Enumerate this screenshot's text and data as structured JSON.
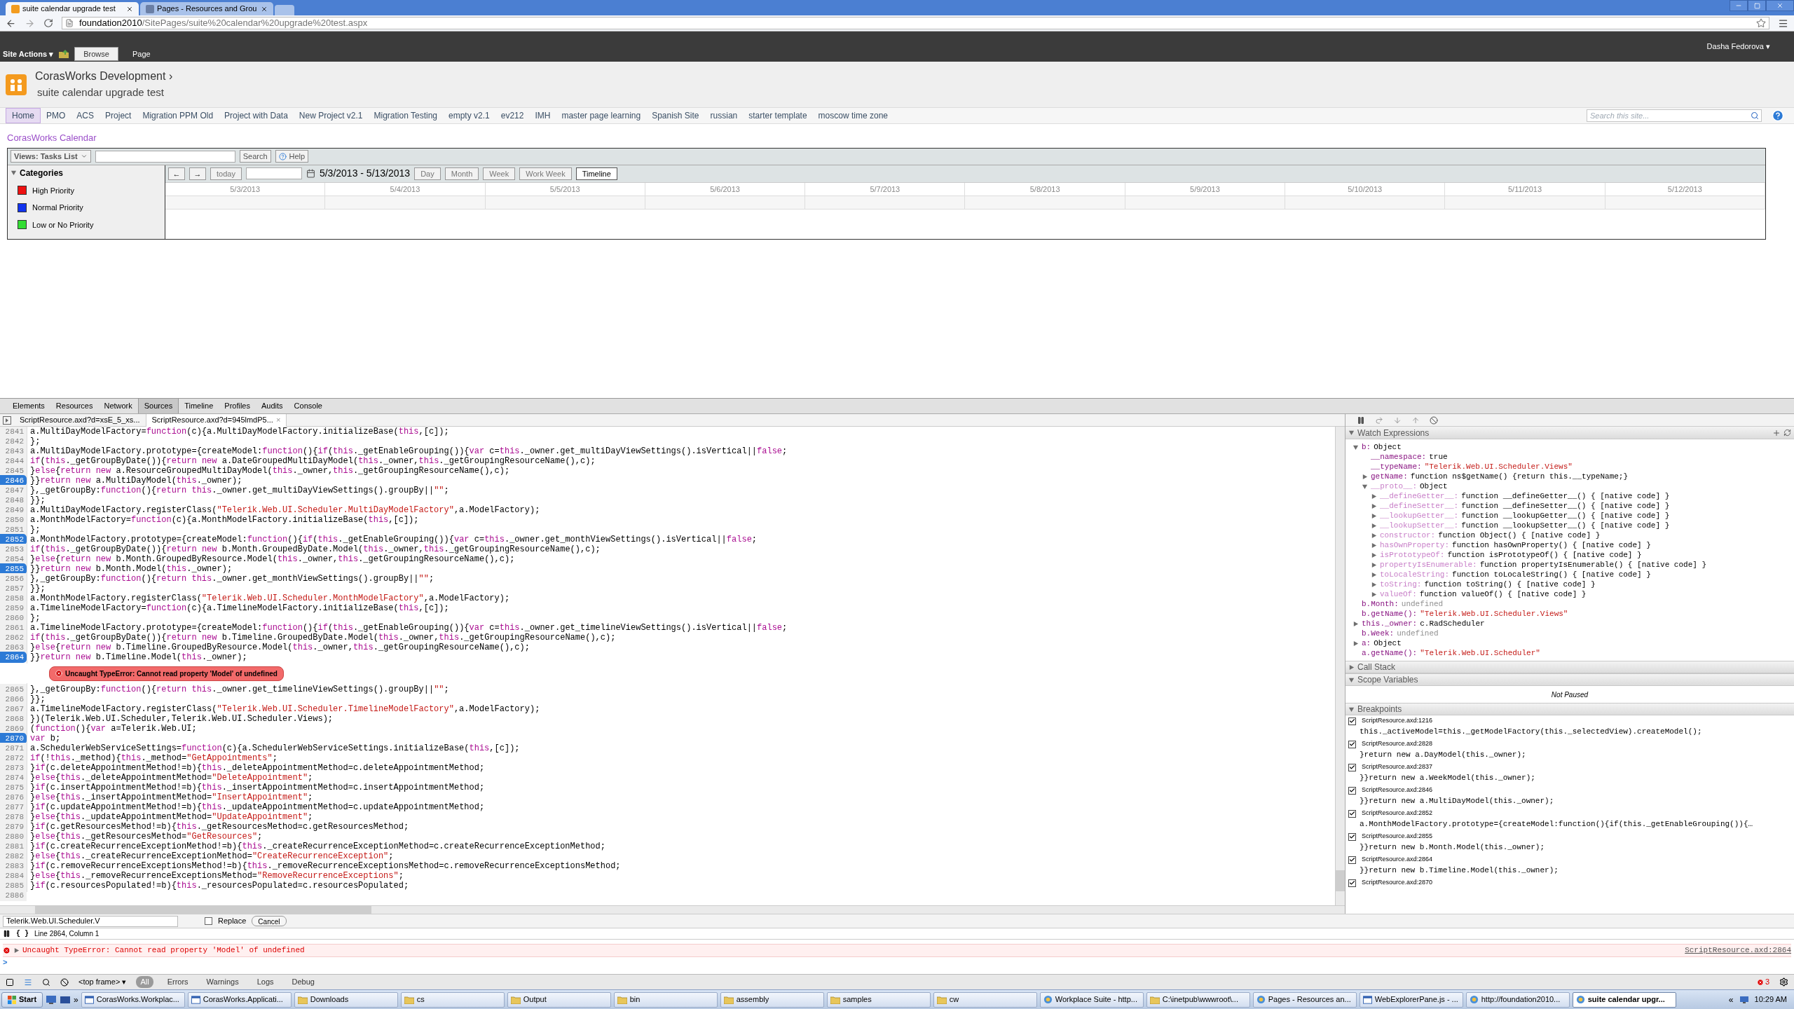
{
  "browser": {
    "tabs": [
      {
        "title": "suite calendar upgrade test",
        "selected": true
      },
      {
        "title": "Pages - Resources and Grou",
        "selected": false
      }
    ],
    "url": {
      "host": "foundation2010",
      "path": "/SitePages/suite%20calendar%20upgrade%20test.aspx"
    }
  },
  "ribbon": {
    "site_actions": "Site Actions",
    "caret": "▾",
    "user_caret": "▾",
    "tabs": [
      {
        "label": "Browse",
        "selected": true
      },
      {
        "label": "Page",
        "selected": false
      }
    ],
    "user": "Dasha Fedorova"
  },
  "site": {
    "title": "CorasWorks Development",
    "title_arrow": "›",
    "page": "suite calendar upgrade test",
    "nav": [
      {
        "label": "Home",
        "selected": true
      },
      {
        "label": "PMO",
        "selected": false
      },
      {
        "label": "ACS",
        "selected": false
      },
      {
        "label": "Project",
        "selected": false
      },
      {
        "label": "Migration PPM Old",
        "selected": false
      },
      {
        "label": "Project with Data",
        "selected": false
      },
      {
        "label": "New Project v2.1",
        "selected": false
      },
      {
        "label": "Migration Testing",
        "selected": false
      },
      {
        "label": "empty v2.1",
        "selected": false
      },
      {
        "label": "ev212",
        "selected": false
      },
      {
        "label": "IMH",
        "selected": false
      },
      {
        "label": "master page learning",
        "selected": false
      },
      {
        "label": "Spanish Site",
        "selected": false
      },
      {
        "label": "russian",
        "selected": false
      },
      {
        "label": "starter template",
        "selected": false
      },
      {
        "label": "moscow time zone",
        "selected": false
      }
    ],
    "search": {
      "placeholder": "Search this site..."
    }
  },
  "calendar": {
    "title": "CorasWorks Calendar",
    "views": "Views: Tasks List",
    "search_button": "Search",
    "help_button": "Help",
    "categories_title": "Categories",
    "categories": [
      {
        "label": "High Priority",
        "color": "#ee1111"
      },
      {
        "label": "Normal Priority",
        "color": "#1133ee"
      },
      {
        "label": "Low or No Priority",
        "color": "#33dd33"
      }
    ],
    "prev": "←",
    "next": "→",
    "today": "today",
    "range": "5/3/2013 - 5/13/2013",
    "views_buttons": [
      {
        "label": "Day",
        "selected": false
      },
      {
        "label": "Month",
        "selected": false
      },
      {
        "label": "Week",
        "selected": false
      },
      {
        "label": "Work Week",
        "selected": false
      },
      {
        "label": "Timeline",
        "selected": true
      }
    ],
    "dates": [
      "5/3/2013",
      "5/4/2013",
      "5/5/2013",
      "5/6/2013",
      "5/7/2013",
      "5/8/2013",
      "5/9/2013",
      "5/10/2013",
      "5/11/2013",
      "5/12/2013"
    ]
  },
  "devtools": {
    "tabs": [
      {
        "label": "Elements",
        "selected": false
      },
      {
        "label": "Resources",
        "selected": false
      },
      {
        "label": "Network",
        "selected": false
      },
      {
        "label": "Sources",
        "selected": true
      },
      {
        "label": "Timeline",
        "selected": false
      },
      {
        "label": "Profiles",
        "selected": false
      },
      {
        "label": "Audits",
        "selected": false
      },
      {
        "label": "Console",
        "selected": false
      }
    ],
    "files": [
      {
        "label": "ScriptResource.axd?d=xsE_5_xs...",
        "selected": false
      },
      {
        "label": "ScriptResource.axd?d=945lmdP5...",
        "selected": true,
        "close": "×"
      }
    ],
    "code": [
      {
        "n": "2841",
        "text": "a.MultiDayModelFactory=function(c){a.MultiDayModelFactory.initializeBase(this,[c]);",
        "breakpoint": false
      },
      {
        "n": "2842",
        "text": "};",
        "breakpoint": false
      },
      {
        "n": "2843",
        "text": "a.MultiDayModelFactory.prototype={createModel:function(){if(this._getEnableGrouping()){var c=this._owner.get_multiDayViewSettings().isVertical||false;",
        "breakpoint": false
      },
      {
        "n": "2844",
        "text": "if(this._getGroupByDate()){return new a.DateGroupedMultiDayModel(this._owner,this._getGroupingResourceName(),c);",
        "breakpoint": false
      },
      {
        "n": "2845",
        "text": "}else{return new a.ResourceGroupedMultiDayModel(this._owner,this._getGroupingResourceName(),c);",
        "breakpoint": false
      },
      {
        "n": "2846",
        "text": "}}return new a.MultiDayModel(this._owner);",
        "breakpoint": true
      },
      {
        "n": "2847",
        "text": "},_getGroupBy:function(){return this._owner.get_multiDayViewSettings().groupBy||\"\";",
        "breakpoint": false
      },
      {
        "n": "2848",
        "text": "}};",
        "breakpoint": false
      },
      {
        "n": "2849",
        "text": "a.MultiDayModelFactory.registerClass(\"Telerik.Web.UI.Scheduler.MultiDayModelFactory\",a.ModelFactory);",
        "breakpoint": false
      },
      {
        "n": "2850",
        "text": "a.MonthModelFactory=function(c){a.MonthModelFactory.initializeBase(this,[c]);",
        "breakpoint": false
      },
      {
        "n": "2851",
        "text": "};",
        "breakpoint": false
      },
      {
        "n": "2852",
        "text": "a.MonthModelFactory.prototype={createModel:function(){if(this._getEnableGrouping()){var c=this._owner.get_monthViewSettings().isVertical||false;",
        "breakpoint": true
      },
      {
        "n": "2853",
        "text": "if(this._getGroupByDate()){return new b.Month.GroupedByDate.Model(this._owner,this._getGroupingResourceName(),c);",
        "breakpoint": false
      },
      {
        "n": "2854",
        "text": "}else{return new b.Month.GroupedByResource.Model(this._owner,this._getGroupingResourceName(),c);",
        "breakpoint": false
      },
      {
        "n": "2855",
        "text": "}}return new b.Month.Model(this._owner);",
        "breakpoint": true
      },
      {
        "n": "2856",
        "text": "},_getGroupBy:function(){return this._owner.get_monthViewSettings().groupBy||\"\";",
        "breakpoint": false
      },
      {
        "n": "2857",
        "text": "}};",
        "breakpoint": false
      },
      {
        "n": "2858",
        "text": "a.MonthModelFactory.registerClass(\"Telerik.Web.UI.Scheduler.MonthModelFactory\",a.ModelFactory);",
        "breakpoint": false
      },
      {
        "n": "2859",
        "text": "a.TimelineModelFactory=function(c){a.TimelineModelFactory.initializeBase(this,[c]);",
        "breakpoint": false
      },
      {
        "n": "2860",
        "text": "};",
        "breakpoint": false
      },
      {
        "n": "2861",
        "text": "a.TimelineModelFactory.prototype={createModel:function(){if(this._getEnableGrouping()){var c=this._owner.get_timelineViewSettings().isVertical||false;",
        "breakpoint": false
      },
      {
        "n": "2862",
        "text": "if(this._getGroupByDate()){return new b.Timeline.GroupedByDate.Model(this._owner,this._getGroupingResourceName(),c);",
        "breakpoint": false
      },
      {
        "n": "2863",
        "text": "}else{return new b.Timeline.GroupedByResource.Model(this._owner,this._getGroupingResourceName(),c);",
        "breakpoint": false
      },
      {
        "n": "2864",
        "text": "}}return new b.Timeline.Model(this._owner);",
        "breakpoint": true,
        "error": "Uncaught TypeError: Cannot read property 'Model' of undefined"
      },
      {
        "n": "2865",
        "text": "},_getGroupBy:function(){return this._owner.get_timelineViewSettings().groupBy||\"\";",
        "breakpoint": false
      },
      {
        "n": "2866",
        "text": "}};",
        "breakpoint": false
      },
      {
        "n": "2867",
        "text": "a.TimelineModelFactory.registerClass(\"Telerik.Web.UI.Scheduler.TimelineModelFactory\",a.ModelFactory);",
        "breakpoint": false
      },
      {
        "n": "2868",
        "text": "})(Telerik.Web.UI.Scheduler,Telerik.Web.UI.Scheduler.Views);",
        "breakpoint": false
      },
      {
        "n": "2869",
        "text": "(function(){var a=Telerik.Web.UI;",
        "breakpoint": false
      },
      {
        "n": "2870",
        "text": "var b;",
        "breakpoint": true
      },
      {
        "n": "2871",
        "text": "a.SchedulerWebServiceSettings=function(c){a.SchedulerWebServiceSettings.initializeBase(this,[c]);",
        "breakpoint": false
      },
      {
        "n": "2872",
        "text": "if(!this._method){this._method=\"GetAppointments\";",
        "breakpoint": false
      },
      {
        "n": "2873",
        "text": "}if(c.deleteAppointmentMethod!=b){this._deleteAppointmentMethod=c.deleteAppointmentMethod;",
        "breakpoint": false
      },
      {
        "n": "2874",
        "text": "}else{this._deleteAppointmentMethod=\"DeleteAppointment\";",
        "breakpoint": false
      },
      {
        "n": "2875",
        "text": "}if(c.insertAppointmentMethod!=b){this._insertAppointmentMethod=c.insertAppointmentMethod;",
        "breakpoint": false
      },
      {
        "n": "2876",
        "text": "}else{this._insertAppointmentMethod=\"InsertAppointment\";",
        "breakpoint": false
      },
      {
        "n": "2877",
        "text": "}if(c.updateAppointmentMethod!=b){this._updateAppointmentMethod=c.updateAppointmentMethod;",
        "breakpoint": false
      },
      {
        "n": "2878",
        "text": "}else{this._updateAppointmentMethod=\"UpdateAppointment\";",
        "breakpoint": false
      },
      {
        "n": "2879",
        "text": "}if(c.getResourcesMethod!=b){this._getResourcesMethod=c.getResourcesMethod;",
        "breakpoint": false
      },
      {
        "n": "2880",
        "text": "}else{this._getResourcesMethod=\"GetResources\";",
        "breakpoint": false
      },
      {
        "n": "2881",
        "text": "}if(c.createRecurrenceExceptionMethod!=b){this._createRecurrenceExceptionMethod=c.createRecurrenceExceptionMethod;",
        "breakpoint": false
      },
      {
        "n": "2882",
        "text": "}else{this._createRecurrenceExceptionMethod=\"CreateRecurrenceException\";",
        "breakpoint": false
      },
      {
        "n": "2883",
        "text": "}if(c.removeRecurrenceExceptionsMethod!=b){this._removeRecurrenceExceptionsMethod=c.removeRecurrenceExceptionsMethod;",
        "breakpoint": false
      },
      {
        "n": "2884",
        "text": "}else{this._removeRecurrenceExceptionsMethod=\"RemoveRecurrenceExceptions\";",
        "breakpoint": false
      },
      {
        "n": "2885",
        "text": "}if(c.resourcesPopulated!=b){this._resourcesPopulated=c.resourcesPopulated;",
        "breakpoint": false
      },
      {
        "n": "2886",
        "breakpoint": false
      }
    ],
    "watch": {
      "title": "Watch Expressions",
      "expanded": true,
      "items": [
        {
          "kind": "node",
          "expanded": true,
          "name": "b:",
          "value": "Object",
          "children": [
            {
              "kind": "leaf",
              "name": "__namespace:",
              "value": "true"
            },
            {
              "kind": "leaf",
              "name": "__typeName:",
              "value": "\"Telerik.Web.UI.Scheduler.Views\"",
              "color": "#c41a16"
            },
            {
              "kind": "node",
              "expanded": false,
              "name": "getName:",
              "value": "function ns$getName() {return this.__typeName;}"
            },
            {
              "kind": "node",
              "expanded": true,
              "name": "__proto__:",
              "value": "Object",
              "dim": true,
              "children": [
                {
                  "kind": "node",
                  "expanded": false,
                  "dim": true,
                  "name": "__defineGetter__:",
                  "value": "function __defineGetter__() { [native code] }"
                },
                {
                  "kind": "node",
                  "expanded": false,
                  "dim": true,
                  "name": "__defineSetter__:",
                  "value": "function __defineSetter__() { [native code] }"
                },
                {
                  "kind": "node",
                  "expanded": false,
                  "dim": true,
                  "name": "__lookupGetter__:",
                  "value": "function __lookupGetter__() { [native code] }"
                },
                {
                  "kind": "node",
                  "expanded": false,
                  "dim": true,
                  "name": "__lookupSetter__:",
                  "value": "function __lookupSetter__() { [native code] }"
                },
                {
                  "kind": "node",
                  "expanded": false,
                  "dim": true,
                  "name": "constructor:",
                  "value": "function Object() { [native code] }"
                },
                {
                  "kind": "node",
                  "expanded": false,
                  "dim": true,
                  "name": "hasOwnProperty:",
                  "value": "function hasOwnProperty() { [native code] }"
                },
                {
                  "kind": "node",
                  "expanded": false,
                  "dim": true,
                  "name": "isPrototypeOf:",
                  "value": "function isPrototypeOf() { [native code] }"
                },
                {
                  "kind": "node",
                  "expanded": false,
                  "dim": true,
                  "name": "propertyIsEnumerable:",
                  "value": "function propertyIsEnumerable() { [native code] }"
                },
                {
                  "kind": "node",
                  "expanded": false,
                  "dim": true,
                  "name": "toLocaleString:",
                  "value": "function toLocaleString() { [native code] }"
                },
                {
                  "kind": "node",
                  "expanded": false,
                  "dim": true,
                  "name": "toString:",
                  "value": "function toString() { [native code] }"
                },
                {
                  "kind": "node",
                  "expanded": false,
                  "dim": true,
                  "name": "valueOf:",
                  "value": "function valueOf() { [native code] }"
                }
              ]
            }
          ]
        },
        {
          "kind": "leaf",
          "name": "b.Month:",
          "value": "undefined",
          "color": "#909090"
        },
        {
          "kind": "leaf",
          "name": "b.getName():",
          "value": "\"Telerik.Web.UI.Scheduler.Views\"",
          "color": "#c41a16"
        },
        {
          "kind": "node",
          "expanded": false,
          "name": "this._owner:",
          "value": "c.RadScheduler"
        },
        {
          "kind": "leaf",
          "name": "b.Week:",
          "value": "undefined",
          "color": "#909090"
        },
        {
          "kind": "node",
          "expanded": false,
          "name": "a:",
          "value": "Object"
        },
        {
          "kind": "leaf",
          "name": "a.getName():",
          "value": "\"Telerik.Web.UI.Scheduler\"",
          "color": "#c41a16"
        }
      ]
    },
    "call_stack": {
      "title": "Call Stack",
      "expanded": false
    },
    "scope": {
      "title": "Scope Variables",
      "expanded": true,
      "message": "Not Paused"
    },
    "breakpoints": {
      "title": "Breakpoints",
      "expanded": true,
      "items": [
        {
          "location": "ScriptResource.axd:1216",
          "code": "this._activeModel=this._getModelFactory(this._selectedView).createModel();",
          "checked": true
        },
        {
          "location": "ScriptResource.axd:2828",
          "code": "}return new a.DayModel(this._owner);",
          "checked": true
        },
        {
          "location": "ScriptResource.axd:2837",
          "code": "}}return new a.WeekModel(this._owner);",
          "checked": true
        },
        {
          "location": "ScriptResource.axd:2846",
          "code": "}}return new a.MultiDayModel(this._owner);",
          "checked": true
        },
        {
          "location": "ScriptResource.axd:2852",
          "code": "a.MonthModelFactory.prototype={createModel:function(){if(this._getEnableGrouping()){…",
          "checked": true
        },
        {
          "location": "ScriptResource.axd:2855",
          "code": "}}return new b.Month.Model(this._owner);",
          "checked": true
        },
        {
          "location": "ScriptResource.axd:2864",
          "code": "}}return new b.Timeline.Model(this._owner);",
          "checked": true
        },
        {
          "location": "ScriptResource.axd:2870",
          "checked": true
        }
      ]
    },
    "search": {
      "value": "Telerik.Web.UI.Scheduler.V",
      "replace_label": "Replace",
      "replace_checked": false,
      "cancel": "Cancel"
    },
    "status": "Line 2864, Column 1",
    "pretty_print": "{ }",
    "console": {
      "messages": [
        {
          "text": "Uncaught TypeError: Cannot read property 'Model' of undefined",
          "source": "ScriptResource.axd:2864"
        }
      ],
      "prompt": ">",
      "frame": "<top frame>",
      "frame_caret": "▾",
      "filters": [
        {
          "label": "All",
          "selected": true
        },
        {
          "label": "Errors",
          "selected": false
        },
        {
          "label": "Warnings",
          "selected": false
        },
        {
          "label": "Logs",
          "selected": false
        },
        {
          "label": "Debug",
          "selected": false
        }
      ],
      "error_count": "3"
    }
  },
  "taskbar": {
    "start": "Start",
    "more": "»",
    "tray_more": "«",
    "items": [
      {
        "label": "CorasWorks.Workplac...",
        "kind": "app",
        "selected": false
      },
      {
        "label": "CorasWorks.Applicati...",
        "kind": "app",
        "selected": false
      },
      {
        "label": "Downloads",
        "kind": "folder",
        "selected": false
      },
      {
        "label": "cs",
        "kind": "folder",
        "selected": false
      },
      {
        "label": "Output",
        "kind": "folder",
        "selected": false
      },
      {
        "label": "bin",
        "kind": "folder",
        "selected": false
      },
      {
        "label": "assembly",
        "kind": "folder",
        "selected": false
      },
      {
        "label": "samples",
        "kind": "folder",
        "selected": false
      },
      {
        "label": "cw",
        "kind": "folder",
        "selected": false
      },
      {
        "label": "Workplace Suite - http...",
        "kind": "browser",
        "selected": false
      },
      {
        "label": "C:\\inetpub\\wwwroot\\...",
        "kind": "folder",
        "selected": false
      },
      {
        "label": "Pages - Resources an...",
        "kind": "browser",
        "selected": false
      },
      {
        "label": "WebExplorerPane.js - ...",
        "kind": "app",
        "selected": false
      },
      {
        "label": "http://foundation2010...",
        "kind": "browser",
        "selected": false
      },
      {
        "label": "suite calendar upgr...",
        "kind": "browser",
        "selected": true
      }
    ],
    "clock": "10:29 AM"
  }
}
